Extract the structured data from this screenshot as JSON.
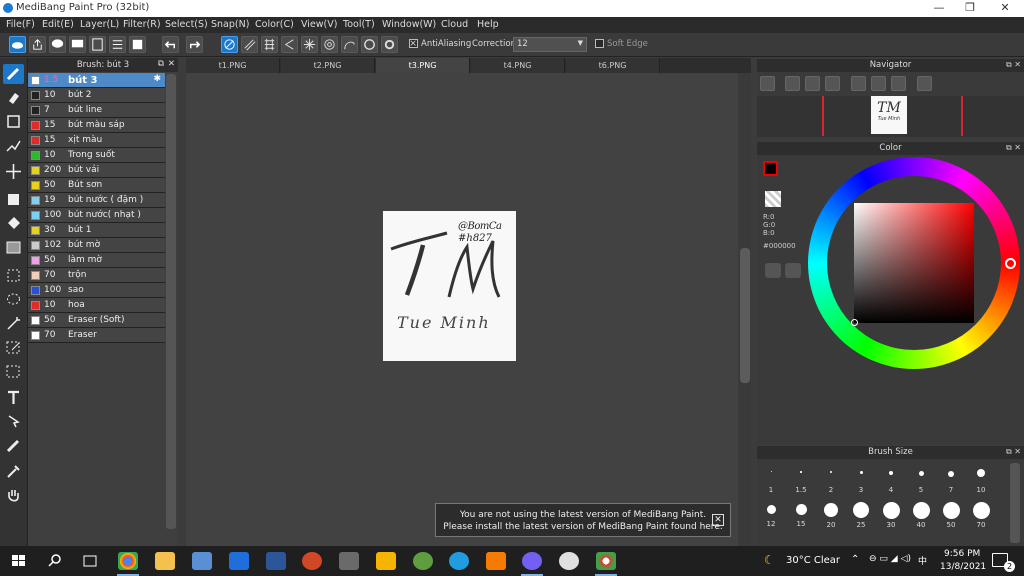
{
  "window": {
    "title": "MediBang Paint Pro (32bit)",
    "minimize": "—",
    "maximize": "❐",
    "close": "✕"
  },
  "menu": [
    "File(F)",
    "Edit(E)",
    "Layer(L)",
    "Filter(R)",
    "Select(S)",
    "Snap(N)",
    "Color(C)",
    "View(V)",
    "Tool(T)",
    "Window(W)",
    "Cloud",
    "Help"
  ],
  "toolbar": {
    "antialias_label": "AntiAliasing",
    "antialias_checked": true,
    "correction_label": "Correction",
    "correction_value": "12",
    "softedge_label": "Soft Edge",
    "softedge_checked": false
  },
  "brush_panel": {
    "title": "Brush: bút 3",
    "brushes": [
      {
        "size": "1.5",
        "name": "bút 3",
        "color": "#ffffff",
        "selected": true
      },
      {
        "size": "10",
        "name": "bút 2",
        "color": "#222222"
      },
      {
        "size": "7",
        "name": "bút line",
        "color": "#222222"
      },
      {
        "size": "15",
        "name": "bút màu sáp",
        "color": "#e32a2a"
      },
      {
        "size": "15",
        "name": "xịt màu",
        "color": "#e32a2a"
      },
      {
        "size": "10",
        "name": "Trong suốt",
        "color": "#2fb82f"
      },
      {
        "size": "200",
        "name": "bút vải",
        "color": "#e6d21c"
      },
      {
        "size": "50",
        "name": "Bút sơn",
        "color": "#e6d21c"
      },
      {
        "size": "19",
        "name": "bút nước ( đậm )",
        "color": "#7fd0f0"
      },
      {
        "size": "100",
        "name": "bút nước( nhạt )",
        "color": "#7fd0f0"
      },
      {
        "size": "30",
        "name": "bút 1",
        "color": "#e6d21c"
      },
      {
        "size": "102",
        "name": "bút mờ",
        "color": "#cccccc"
      },
      {
        "size": "50",
        "name": "làm mờ",
        "color": "#f0a0e8"
      },
      {
        "size": "70",
        "name": "trộn",
        "color": "#f0d0b8"
      },
      {
        "size": "100",
        "name": "sao",
        "color": "#2a4fd8"
      },
      {
        "size": "10",
        "name": "hoa",
        "color": "#e32a2a"
      },
      {
        "size": "50",
        "name": "Eraser (Soft)",
        "color": "#ffffff"
      },
      {
        "size": "70",
        "name": "Eraser",
        "color": "#ffffff"
      }
    ]
  },
  "tabs": [
    "t1.PNG",
    "t2.PNG",
    "t3.PNG",
    "t4.PNG",
    "t6.PNG"
  ],
  "active_tab": "t3.PNG",
  "artwork": {
    "main": "TM",
    "sub": "Tue Minh",
    "handle_line1": "@BomCa",
    "handle_line2": "#h827"
  },
  "notice": {
    "line1": "You are not using the latest version of MediBang Paint.",
    "line2": "Please install the latest version of MediBang Paint found here.",
    "close": "✕"
  },
  "navigator": {
    "title": "Navigator",
    "thumb_main": "TM",
    "thumb_sub": "Tue Minh"
  },
  "color": {
    "title": "Color",
    "r": "R:0",
    "g": "G:0",
    "b": "B:0",
    "hex": "#000000",
    "current": "#000000"
  },
  "brush_size": {
    "title": "Brush Size",
    "row1": [
      "1",
      "1.5",
      "2",
      "3",
      "4",
      "5",
      "7",
      "10"
    ],
    "row2": [
      "12",
      "15",
      "20",
      "25",
      "30",
      "40",
      "50",
      "70"
    ]
  },
  "taskbar": {
    "weather": "30°C Clear",
    "time": "9:56 PM",
    "date": "13/8/2021",
    "notif_count": "2"
  }
}
